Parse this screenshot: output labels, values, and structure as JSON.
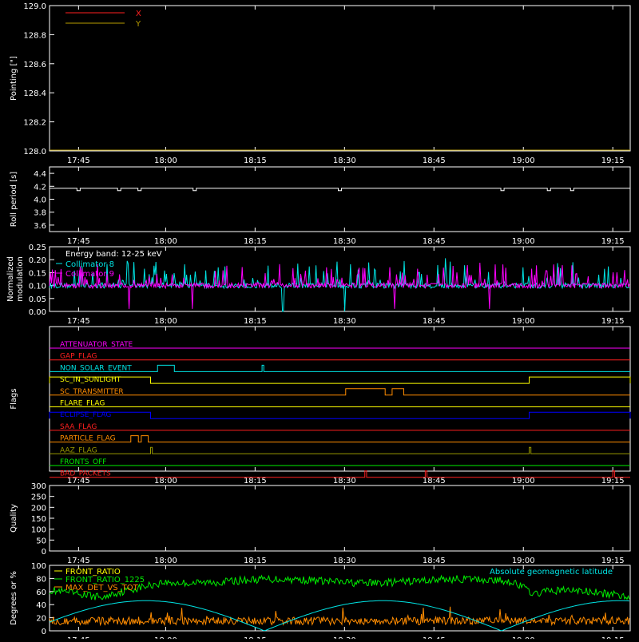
{
  "time_ticks": [
    "17:45",
    "18:00",
    "18:15",
    "18:30",
    "18:45",
    "19:00",
    "19:15"
  ],
  "chart_data": [
    {
      "type": "line",
      "ylabel": "Pointing [\"]",
      "ylim": [
        128.0,
        129.0
      ],
      "yticks": [
        "129.0",
        "128.8",
        "128.6",
        "128.4",
        "128.2",
        "128.0"
      ],
      "legend": [
        {
          "name": "X",
          "color": "#ff2020"
        },
        {
          "name": "Y",
          "color": "#b89b00"
        }
      ],
      "series": [
        {
          "name": "X",
          "color": "#ff2020",
          "values": []
        },
        {
          "name": "Y",
          "color": "#b89b00",
          "values": [
            128.0,
            128.0
          ]
        }
      ]
    },
    {
      "type": "line",
      "ylabel": "Roll period [s]",
      "ylim": [
        3.5,
        4.5
      ],
      "yticks": [
        "4.4",
        "4.2",
        "4.0",
        "3.8",
        "3.6"
      ],
      "series": [
        {
          "name": "roll",
          "color": "#ffffff",
          "baseline": 4.17,
          "dips": [
            0.05,
            0.12,
            0.155,
            0.25,
            0.5,
            0.78,
            0.86,
            0.9
          ]
        }
      ]
    },
    {
      "type": "line",
      "ylabel": "Normalized modulation",
      "ylim": [
        0.0,
        0.25
      ],
      "yticks": [
        "0.25",
        "0.20",
        "0.15",
        "0.10",
        "0.05",
        "0.00"
      ],
      "annotation": "Energy band: 12-25 keV",
      "legend": [
        {
          "name": "Collimator 8",
          "color": "#00e5e5"
        },
        {
          "name": "Collimator 9",
          "color": "#ff00ff"
        }
      ],
      "series": [
        {
          "name": "Collimator 8",
          "color": "#00e5e5",
          "level": 0.1,
          "gaps": [
            [
              0.4,
              0.51
            ]
          ]
        },
        {
          "name": "Collimator 9",
          "color": "#ff00ff",
          "level": 0.1
        }
      ]
    },
    {
      "type": "step",
      "ylabel": "Flags",
      "flags": [
        {
          "label": "ATTENUATOR_STATE",
          "color": "#ff00ff",
          "pulses": []
        },
        {
          "label": "GAP_FLAG",
          "color": "#ff2020",
          "pulses": []
        },
        {
          "label": "NON_SOLAR_EVENT",
          "color": "#00e5e5",
          "pulses": [
            [
              0.186,
              0.215
            ],
            [
              0.366,
              0.369
            ]
          ]
        },
        {
          "label": "SC_IN_SUNLIGHT",
          "color": "#ffff00",
          "pulses": [
            [
              0.0,
              0.174
            ],
            [
              0.826,
              1.0
            ]
          ]
        },
        {
          "label": "SC_TRANSMITTER",
          "color": "#ff8c00",
          "pulses": [
            [
              0.51,
              0.578
            ],
            [
              0.59,
              0.61
            ]
          ]
        },
        {
          "label": "FLARE_FLAG",
          "color": "#ffff00",
          "pulses": []
        },
        {
          "label": "ECLIPSE_FLAG",
          "color": "#0000ff",
          "pulses": [
            [
              0.0,
              0.174
            ],
            [
              0.826,
              1.0
            ]
          ]
        },
        {
          "label": "SAA_FLAG",
          "color": "#ff2020",
          "pulses": []
        },
        {
          "label": "PARTICLE_FLAG",
          "color": "#ff8c00",
          "pulses": [
            [
              0.14,
              0.153
            ],
            [
              0.158,
              0.17
            ]
          ]
        },
        {
          "label": "AAZ_FLAG",
          "color": "#9a9a00",
          "pulses": [
            [
              0.174,
              0.177
            ],
            [
              0.826,
              0.829
            ]
          ]
        },
        {
          "label": "FRONTS_OFF",
          "color": "#00ee00",
          "pulses": []
        },
        {
          "label": "BAD_PACKETS",
          "color": "#ff2020",
          "pulses": [
            [
              0.543,
              0.546
            ],
            [
              0.647,
              0.65
            ],
            [
              0.97,
              0.973
            ]
          ]
        }
      ]
    },
    {
      "type": "line",
      "ylabel": "Quality",
      "ylim": [
        0,
        300
      ],
      "yticks": [
        "300",
        "250",
        "200",
        "150",
        "100",
        "50",
        "0"
      ],
      "series": []
    },
    {
      "type": "line",
      "ylabel": "Degrees or %",
      "ylim": [
        0,
        100
      ],
      "yticks": [
        "100",
        "80",
        "60",
        "40",
        "20",
        "0"
      ],
      "annotation": "Absolute geomagnetic latitude",
      "legend": [
        {
          "name": "FRONT_RATIO",
          "color": "#ffff00"
        },
        {
          "name": "FRONT_RATIO_1225",
          "color": "#00ee00"
        },
        {
          "name": "MAX_DET_VS_TOT",
          "color": "#ff8c00"
        }
      ],
      "series": [
        {
          "name": "FRONT_RATIO_1225",
          "color": "#00ee00"
        },
        {
          "name": "MAX_DET_VS_TOT",
          "color": "#ff8c00"
        },
        {
          "name": "Absolute geomagnetic latitude",
          "color": "#00e5e5"
        }
      ]
    }
  ]
}
